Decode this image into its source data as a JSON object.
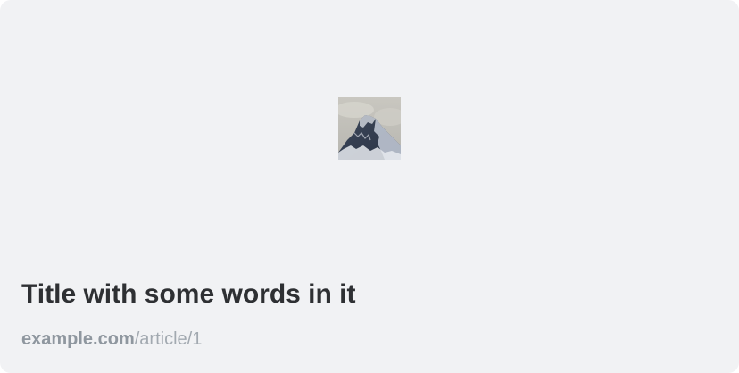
{
  "card": {
    "title": "Title with some words in it",
    "domain": "example.com",
    "path": "/article/1",
    "thumbnail_icon": "mountain-image"
  },
  "colors": {
    "card_background": "#f1f2f4",
    "title": "#2e3033",
    "link_domain": "#8f979f",
    "link_path": "#a2a9b0"
  }
}
